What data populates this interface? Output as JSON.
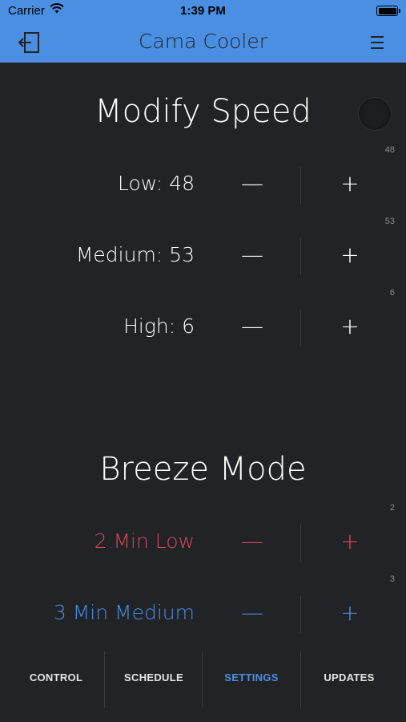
{
  "status_bar": {
    "carrier": "Carrier",
    "time": "1:39 PM"
  },
  "header": {
    "title": "Cama Cooler",
    "back_icon": "logout-icon",
    "menu_icon": "menu-icon"
  },
  "modify_speed": {
    "title": "Modify Speed",
    "rows": [
      {
        "label": "Low: 48",
        "minus": "—",
        "plus": "+",
        "side_value": "48",
        "color": "#ffffff"
      },
      {
        "label": "Medium: 53",
        "minus": "—",
        "plus": "+",
        "side_value": "53",
        "color": "#ffffff"
      },
      {
        "label": "High: 6",
        "minus": "—",
        "plus": "+",
        "side_value": "6",
        "color": "#ffffff"
      }
    ]
  },
  "breeze_mode": {
    "title": "Breeze Mode",
    "rows": [
      {
        "label": "2 Min Low",
        "minus": "—",
        "plus": "+",
        "side_value": "2",
        "color": "#d5485d"
      },
      {
        "label": "3 Min Medium",
        "minus": "—",
        "plus": "+",
        "side_value": "3",
        "color": "#4a8fe2"
      }
    ]
  },
  "tabs": [
    {
      "label": "CONTROL",
      "active": false
    },
    {
      "label": "SCHEDULE",
      "active": false
    },
    {
      "label": "SETTINGS",
      "active": true
    },
    {
      "label": "UPDATES",
      "active": false
    }
  ],
  "colors": {
    "accent": "#4a8fe2",
    "background": "#222326",
    "breeze_low": "#d5485d",
    "breeze_medium": "#4a8fe2"
  }
}
